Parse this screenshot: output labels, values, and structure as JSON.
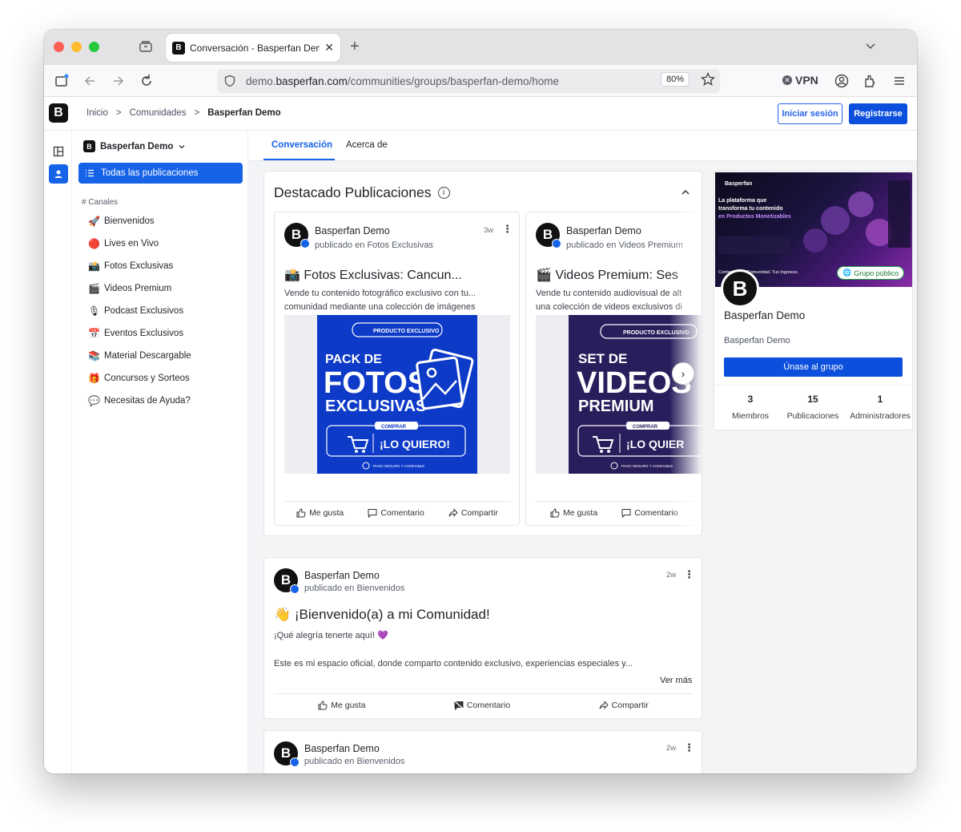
{
  "browser": {
    "tab_title": "Conversación - Basperfan Demo",
    "url_prefix": "demo.",
    "url_domain": "basperfan.com",
    "url_path": "/communities/groups/basperfan-demo/home",
    "zoom": "80%",
    "vpn_label": "VPN"
  },
  "breadcrumb": {
    "items": [
      "Inicio",
      ">",
      "Comunidades",
      ">"
    ],
    "current": "Basperfan Demo"
  },
  "auth": {
    "login": "Iniciar sesión",
    "register": "Registrarse"
  },
  "sidebar": {
    "group_name": "Basperfan Demo",
    "all_posts": "Todas las publicaciones",
    "channels_heading": "Canales",
    "channels": [
      {
        "emoji": "🚀",
        "label": "Bienvenidos"
      },
      {
        "emoji": "🔴",
        "label": "Lives en Vivo"
      },
      {
        "emoji": "📸",
        "label": "Fotos Exclusivas"
      },
      {
        "emoji": "🎬",
        "label": "Videos Premium"
      },
      {
        "emoji": "🎙",
        "label": "Podcast Exclusivos"
      },
      {
        "emoji": "📅",
        "label": "Eventos Exclusivos"
      },
      {
        "emoji": "📚",
        "label": "Material Descargable"
      },
      {
        "emoji": "🎁",
        "label": "Concursos y Sorteos"
      },
      {
        "emoji": "💬",
        "label": "Necesitas de Ayuda?"
      }
    ]
  },
  "main_tabs": [
    "Conversación",
    "Acerca de"
  ],
  "featured": {
    "heading": "Destacado Publicaciones",
    "posts": [
      {
        "author": "Basperfan Demo",
        "posted_in": "publicado en Fotos Exclusivas",
        "ago": "3w",
        "title": "📸 Fotos Exclusivas: Cancun...",
        "desc1": "Vende tu contenido fotográfico exclusivo con tu...",
        "desc2": "comunidad mediante una colección de imágenes",
        "promo": {
          "tag": "PRODUCTO EXCLUSIVO",
          "line1": "PACK DE",
          "line2": "FOTOS",
          "line3": "EXCLUSIVAS",
          "buy": "COMPRAR",
          "cta": "¡LO QUIERO!",
          "secure": "PAGO SEGURO Y CONFIABLE"
        }
      },
      {
        "author": "Basperfan Demo",
        "posted_in": "publicado en Videos Premium",
        "ago": "",
        "title": "🎬 Videos Premium: Ses",
        "desc1": "Vende tu contenido audiovisual de alt",
        "desc2": "una colección de videos exclusivos di",
        "promo": {
          "tag": "PRODUCTO EXCLUSIVO",
          "line1": "SET DE",
          "line2": "VIDEOS",
          "line3": "PREMIUM",
          "buy": "COMPRAR",
          "cta": "¡LO QUIER",
          "secure": "PAGO SEGURO Y CONFIABLE"
        }
      }
    ],
    "actions": {
      "like": "Me gusta",
      "comment": "Comentario",
      "share": "Compartir"
    }
  },
  "posts": [
    {
      "author": "Basperfan Demo",
      "posted_in": "publicado en Bienvenidos",
      "ago": "2w",
      "title": "👋 ¡Bienvenido(a) a mi Comunidad!",
      "body1": "¡Qué alegría tenerte aquí! 💜",
      "body2": "Este es mi espacio oficial, donde comparto contenido exclusivo, experiencias especiales y...",
      "more": "Ver más"
    },
    {
      "author": "Basperfan Demo",
      "posted_in": "publicado en Bienvenidos",
      "ago": "2w"
    }
  ],
  "group_card": {
    "banner_brand": "Basperfan",
    "banner_text1": "La plataforma que",
    "banner_text2": "transforma tu contenido",
    "banner_text3": "en Productos Monetizables",
    "banner_footer": "Contenido. Tu Comunidad. Tus Ingresos.",
    "public_badge": "Grupo público",
    "name": "Basperfan Demo",
    "subtitle": "Basperfan Demo",
    "join": "Únase al grupo",
    "stats": [
      {
        "value": "3",
        "label": "Miembros"
      },
      {
        "value": "15",
        "label": "Publicaciones"
      },
      {
        "value": "1",
        "label": "Administradores"
      }
    ]
  },
  "colors": {
    "accent": "#1663e8",
    "primary_button": "#0b4fdc"
  }
}
